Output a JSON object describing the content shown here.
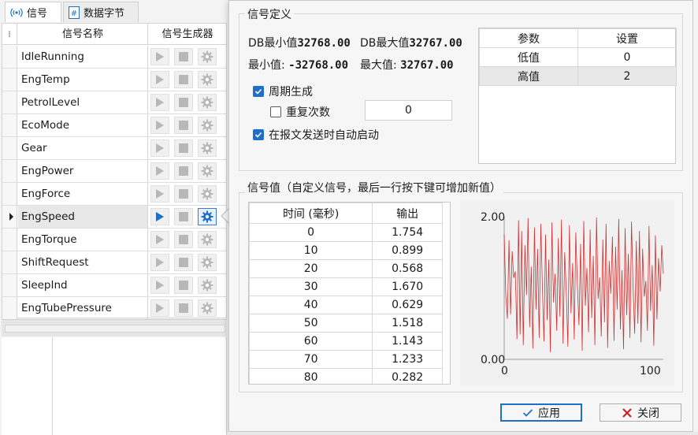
{
  "tabs": [
    {
      "label": "信号",
      "icon": "signal-icon"
    },
    {
      "label": "数据字节",
      "icon": "hash-icon"
    }
  ],
  "signal_grid": {
    "headers": {
      "name": "信号名称",
      "generator": "信号生成器"
    },
    "selected_index": 7,
    "rows": [
      {
        "name": "IdleRunning"
      },
      {
        "name": "EngTemp"
      },
      {
        "name": "PetrolLevel"
      },
      {
        "name": "EcoMode"
      },
      {
        "name": "Gear"
      },
      {
        "name": "EngPower"
      },
      {
        "name": "EngForce"
      },
      {
        "name": "EngSpeed"
      },
      {
        "name": "EngTorque"
      },
      {
        "name": "ShiftRequest"
      },
      {
        "name": "SleepInd"
      },
      {
        "name": "EngTubePressure"
      }
    ]
  },
  "signal_def": {
    "title": "信号定义",
    "db_min_label": "DB最小值",
    "db_min_value": "32768.00",
    "db_max_label": "DB最大值",
    "db_max_value": "32767.00",
    "min_label": "最小值:",
    "min_value": "-32768.00",
    "max_label": "最大值:",
    "max_value": "32767.00",
    "periodic_label": "周期生成",
    "periodic_checked": true,
    "repeat_label": "重复次数",
    "repeat_checked": false,
    "repeat_value": "0",
    "auto_start_label": "在报文发送时自动启动",
    "auto_start_checked": true
  },
  "params_table": {
    "headers": [
      "参数",
      "设置"
    ],
    "rows": [
      [
        "低值",
        "0"
      ],
      [
        "高值",
        "2"
      ]
    ],
    "selected_row": 1
  },
  "signal_values": {
    "title": "信号值（自定义信号，最后一行按下键可增加新值）",
    "headers": [
      "时间 (毫秒)",
      "输出"
    ],
    "rows": [
      [
        "0",
        "1.754"
      ],
      [
        "10",
        "0.899"
      ],
      [
        "20",
        "0.568"
      ],
      [
        "30",
        "1.670"
      ],
      [
        "40",
        "0.629"
      ],
      [
        "50",
        "1.518"
      ],
      [
        "60",
        "1.143"
      ],
      [
        "70",
        "1.233"
      ],
      [
        "80",
        "0.282"
      ]
    ]
  },
  "chart_data": {
    "type": "line",
    "title": "",
    "xlabel": "",
    "ylabel": "",
    "x_ticks": [
      "0",
      "100"
    ],
    "y_ticks": [
      "0.00",
      "2.00"
    ],
    "xlim": [
      0,
      100
    ],
    "ylim": [
      0,
      2
    ],
    "grid": false,
    "color": "#d03030",
    "values": [
      1.754,
      0.899,
      0.568,
      1.67,
      0.629,
      1.518,
      1.143,
      1.233,
      0.282,
      1.95,
      0.35,
      1.8,
      0.2,
      1.6,
      0.9,
      1.98,
      0.45,
      1.3,
      0.15,
      1.85,
      0.7,
      1.55,
      0.3,
      1.9,
      1.0,
      0.25,
      1.75,
      0.55,
      1.4,
      0.1,
      1.92,
      0.8,
      1.2,
      0.4,
      1.7,
      0.6,
      1.96,
      0.22,
      1.5,
      0.95,
      0.18,
      1.88,
      0.65,
      1.35,
      0.28,
      1.78,
      1.05,
      0.48,
      1.62,
      0.12,
      1.94,
      0.75,
      1.28,
      0.38,
      1.82,
      0.58,
      1.45,
      0.2,
      1.99,
      0.85,
      1.15,
      0.32,
      1.68,
      0.52,
      1.9,
      0.16,
      1.38,
      0.92,
      1.72,
      0.26,
      1.58,
      0.7,
      1.97,
      0.42,
      1.25,
      0.14,
      1.84,
      0.62,
      1.48,
      0.3,
      1.93,
      1.02,
      0.36,
      1.66,
      0.5,
      1.8,
      0.24,
      1.55,
      0.88,
      1.1,
      0.4,
      1.87,
      0.68,
      1.32,
      0.19,
      1.74,
      0.56,
      1.42,
      0.95,
      1.6,
      1.2
    ]
  },
  "buttons": {
    "apply": "应用",
    "close": "关闭"
  },
  "colors": {
    "accent": "#1f6fc9",
    "chart_line": "#d03030",
    "close_x": "#d02020"
  }
}
